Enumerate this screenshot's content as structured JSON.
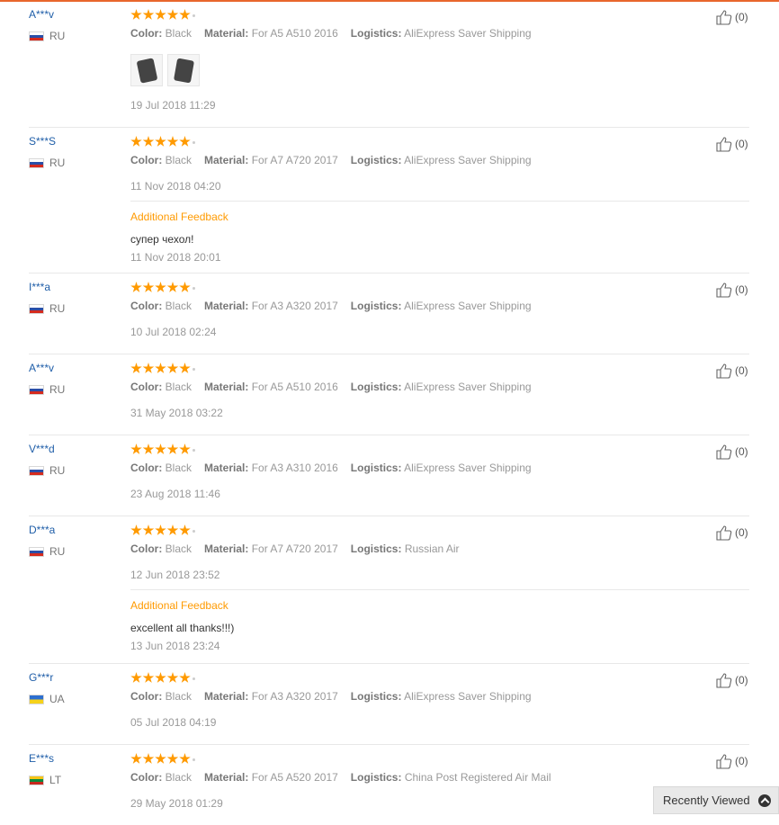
{
  "labels": {
    "color": "Color:",
    "material": "Material:",
    "logistics": "Logistics:"
  },
  "reviews": [
    {
      "user": "A***v",
      "country": "RU",
      "flag": "ru",
      "color": "Black",
      "material": "For A5 A510 2016",
      "logistics": "AliExpress Saver Shipping",
      "date": "19 Jul 2018 11:29",
      "helpful": "(0)",
      "rating": 5,
      "photos": [
        "phone-case-photo-1",
        "phone-case-photo-2"
      ]
    },
    {
      "user": "S***S",
      "country": "RU",
      "flag": "ru",
      "color": "Black",
      "material": "For A7 A720 2017",
      "logistics": "AliExpress Saver Shipping",
      "date": "11 Nov 2018 04:20",
      "helpful": "(0)",
      "rating": 5,
      "additional": {
        "title": "Additional Feedback",
        "text": "супер чехол!",
        "date": "11 Nov 2018 20:01"
      }
    },
    {
      "user": "I***a",
      "country": "RU",
      "flag": "ru",
      "color": "Black",
      "material": "For A3 A320 2017",
      "logistics": "AliExpress Saver Shipping",
      "date": "10 Jul 2018 02:24",
      "helpful": "(0)",
      "rating": 5
    },
    {
      "user": "A***v",
      "country": "RU",
      "flag": "ru",
      "color": "Black",
      "material": "For A5 A510 2016",
      "logistics": "AliExpress Saver Shipping",
      "date": "31 May 2018 03:22",
      "helpful": "(0)",
      "rating": 5
    },
    {
      "user": "V***d",
      "country": "RU",
      "flag": "ru",
      "color": "Black",
      "material": "For A3 A310 2016",
      "logistics": "AliExpress Saver Shipping",
      "date": "23 Aug 2018 11:46",
      "helpful": "(0)",
      "rating": 5
    },
    {
      "user": "D***a",
      "country": "RU",
      "flag": "ru",
      "color": "Black",
      "material": "For A7 A720 2017",
      "logistics": "Russian Air",
      "date": "12 Jun 2018 23:52",
      "helpful": "(0)",
      "rating": 5,
      "additional": {
        "title": "Additional Feedback",
        "text": "excellent all thanks!!!)",
        "date": "13 Jun 2018 23:24"
      }
    },
    {
      "user": "G***r",
      "country": "UA",
      "flag": "ua",
      "color": "Black",
      "material": "For A3 A320 2017",
      "logistics": "AliExpress Saver Shipping",
      "date": "05 Jul 2018 04:19",
      "helpful": "(0)",
      "rating": 5
    },
    {
      "user": "E***s",
      "country": "LT",
      "flag": "lt",
      "color": "Black",
      "material": "For A5 A520 2017",
      "logistics": "China Post Registered Air Mail",
      "date": "29 May 2018 01:29",
      "helpful": "(0)",
      "rating": 5
    }
  ],
  "recently_viewed": {
    "label": "Recently Viewed",
    "icon": "chevron-up-icon"
  },
  "colors": {
    "accent_orange": "#ff9a00",
    "username_blue": "#1f5ea8",
    "top_border": "#e8662c"
  }
}
